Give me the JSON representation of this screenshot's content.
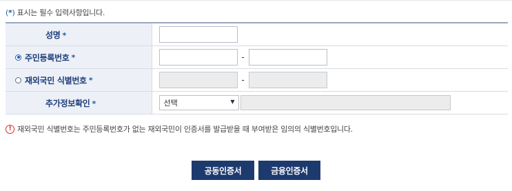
{
  "notice": {
    "paren_open": "(",
    "star": "*",
    "paren_close": ")",
    "text": " 표시는 필수 입력사항입니다."
  },
  "form": {
    "rows": [
      {
        "label": "성명",
        "required": "*"
      },
      {
        "label": "주민등록번호",
        "required": "*",
        "radio_selected": true
      },
      {
        "label": "재외국민 식별번호",
        "required": "*",
        "radio_selected": false
      },
      {
        "label": "추가정보확인",
        "required": "*"
      }
    ],
    "name_value": "",
    "rrn_front": "",
    "rrn_back": "",
    "foreign_front": "",
    "foreign_back": "",
    "dash": "-",
    "extra_select": {
      "selected": "선택",
      "arrow": "▼"
    },
    "extra_value": ""
  },
  "info": {
    "icon": "!",
    "text": "재외국민 식별번호는 주민등록번호가 없는 재외국민이 인증서를 발급받을 때 부여받은 임의의 식별번호입니다."
  },
  "buttons": {
    "joint_cert": "공동인증서",
    "financial_cert": "금융인증서"
  },
  "colors": {
    "label_bg": "#edf0f7",
    "label_text": "#1c3d79",
    "button_bg": "#1c3a6e",
    "warning": "#c8322c"
  }
}
